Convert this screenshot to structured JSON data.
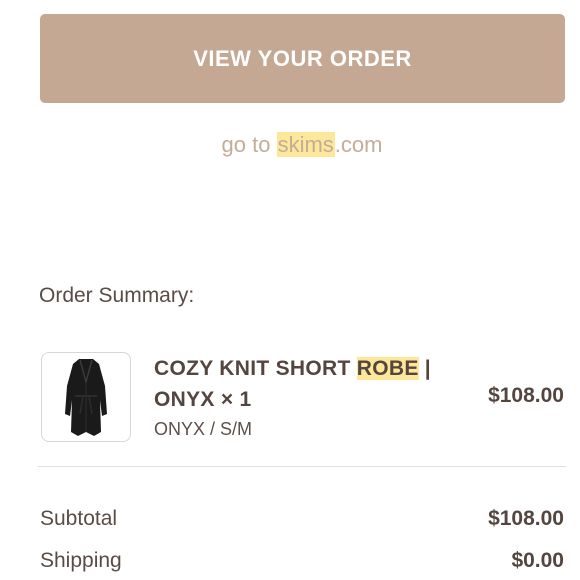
{
  "cta": {
    "label": "VIEW YOUR ORDER"
  },
  "goto": {
    "prefix": "go to ",
    "highlight": "skims",
    "suffix": ".com"
  },
  "summary": {
    "title": "Order Summary:"
  },
  "item": {
    "name_part1": "COZY KNIT SHORT ",
    "name_highlight": "ROBE",
    "name_part2": " | ONYX × 1",
    "variant": "ONYX / S/M",
    "price": "$108.00",
    "image_icon": "robe-image"
  },
  "totals": {
    "subtotal_label": "Subtotal",
    "subtotal_value": "$108.00",
    "shipping_label": "Shipping",
    "shipping_value": "$0.00"
  },
  "colors": {
    "cta_background": "#c5a893",
    "highlight": "#fce79b",
    "link_text": "#c3ad97",
    "body_text": "#54463f"
  }
}
